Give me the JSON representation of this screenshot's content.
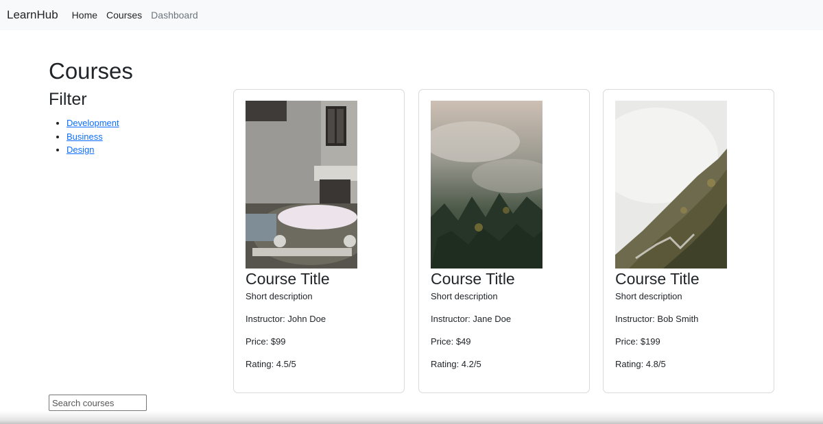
{
  "navbar": {
    "brand": "LearnHub",
    "links": [
      "Home",
      "Courses",
      "Dashboard"
    ]
  },
  "main": {
    "title": "Courses",
    "filter": {
      "title": "Filter",
      "items": [
        "Development",
        "Business",
        "Design"
      ]
    },
    "search": {
      "placeholder": "Search courses",
      "value": ""
    }
  },
  "courses": [
    {
      "title": "Course Title",
      "description": "Short description",
      "instructor": "Instructor: John Doe",
      "price": "Price: $99",
      "rating": "Rating: 4.5/5",
      "image": "old-car-building-photo"
    },
    {
      "title": "Course Title",
      "description": "Short description",
      "instructor": "Instructor: Jane Doe",
      "price": "Price: $49",
      "rating": "Rating: 4.2/5",
      "image": "foggy-forest-photo"
    },
    {
      "title": "Course Title",
      "description": "Short description",
      "instructor": "Instructor: Bob Smith",
      "price": "Price: $199",
      "rating": "Rating: 4.8/5",
      "image": "misty-mountain-photo"
    }
  ],
  "colors": {
    "link": "#0d6efd",
    "navbar_bg": "#f8f9fa",
    "muted": "#6c757d"
  }
}
